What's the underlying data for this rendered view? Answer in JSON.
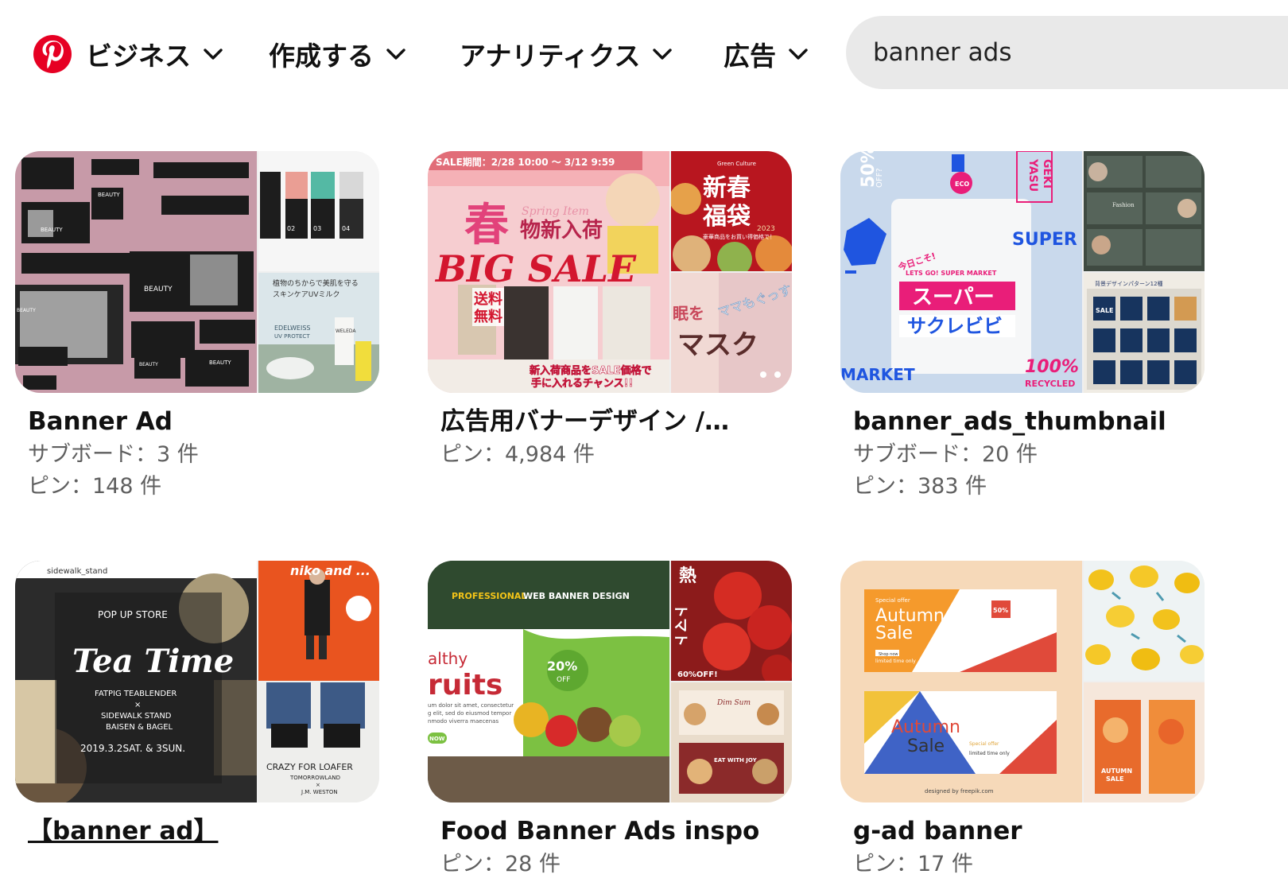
{
  "header": {
    "nav": [
      {
        "label": "ビジネス"
      },
      {
        "label": "作成する"
      },
      {
        "label": "アナリティクス"
      },
      {
        "label": "広告"
      }
    ],
    "search": {
      "value": "banner ads"
    }
  },
  "colors": {
    "brand": "#e60023",
    "search_bg": "#e9e9e9",
    "meta_text": "#5f5f5f"
  },
  "boards": [
    {
      "title": "Banner Ad",
      "subboards": "サブボード：3 件",
      "pins": "ピン：148 件",
      "cover_text": {
        "a": "BEAUTY",
        "b": "BEAUTY",
        "c": "BEAUTY",
        "d": "BEAUTY",
        "e": "BEAUTY",
        "f": "BEAUTY",
        "g": "02",
        "h": "03",
        "i": "04",
        "j": "植物のちからで美肌を守る",
        "k": "スキンケアUVミルク",
        "l": "EDELWEISS",
        "m": "UV PROTECT",
        "n": "WELEDA"
      }
    },
    {
      "title": "広告用バナーデザイン /…",
      "pins": "ピン：4,984 件",
      "cover_text": {
        "a": "SALE期間：2/28 10:00 〜 3/12 9:59",
        "b": "春",
        "c": "Spring Item",
        "d": "物新入荷",
        "e": "BIG SALE",
        "f": "送料",
        "g": "無料",
        "h": "新入荷商品をSALE価格で",
        "i": "手に入れるチャンス!!",
        "j": "新春",
        "k": "福袋",
        "l": "2023",
        "m": "Green Culture",
        "n": "豪華商品をお買い得価格で！",
        "o": "ママもぐっすり",
        "p": "眠を",
        "q": "マスク"
      }
    },
    {
      "title": "banner_ads_thumbnail",
      "subboards": "サブボード：20 件",
      "pins": "ピン：383 件",
      "cover_text": {
        "a": "50%",
        "b": "OFF?",
        "c": "GEKI",
        "d": "YASU",
        "e": "ECO",
        "f": "SUPER",
        "g": "今日こそ!",
        "h": "LETS GO! SUPER MARKET",
        "i": "スーパー",
        "j": "サクレビビ",
        "k": "MARKET",
        "l": "100%",
        "m": "RECYCLED",
        "n": "Fashion",
        "o": "背景デザインパターン12種",
        "p": "SALE"
      }
    },
    {
      "title": "【banner ad】",
      "cover_text": {
        "a": "sidewalk_stand",
        "b": "POP UP STORE",
        "c": "Tea Time",
        "d": "FATPIG TEABLENDER",
        "e": "×",
        "f": "SIDEWALK STAND",
        "g": "BAISEN & BAGEL",
        "h": "2019.3.2SAT. & 3SUN.",
        "i": "niko and ...",
        "j": "CRAZY FOR LOAFER",
        "k": "TOMORROWLAND",
        "l": "×",
        "m": "J.M. WESTON"
      }
    },
    {
      "title": "Food Banner Ads inspo",
      "pins": "ピン：28 件",
      "cover_text": {
        "a": "PROFESSIONAL",
        "b": "WEB BANNER DESIGN",
        "c": "althy",
        "d": "ruits",
        "e": "20%",
        "f": "OFF",
        "g": "um dolor sit amet, consectetur",
        "h": "g elit, sed do eiusmod tempor",
        "i": "nmodo viverra maecenas",
        "j": "NOW",
        "k": "熱",
        "l": "トマト",
        "m": "60%OFF!",
        "n": "Dim Sum",
        "o": "EAT WITH JOY"
      }
    },
    {
      "title": "g-ad banner",
      "pins": "ピン：17 件",
      "cover_text": {
        "a": "Special offer",
        "b": "Autumn",
        "c": "Sale",
        "d": "50%",
        "e": "limited time only",
        "f": "Shop now",
        "g": "Autumn",
        "h": "Sale",
        "i": "Special offer",
        "j": "limited time only",
        "k": "designed by freepik.com",
        "l": "AUTUMN",
        "m": "SALE"
      }
    }
  ]
}
